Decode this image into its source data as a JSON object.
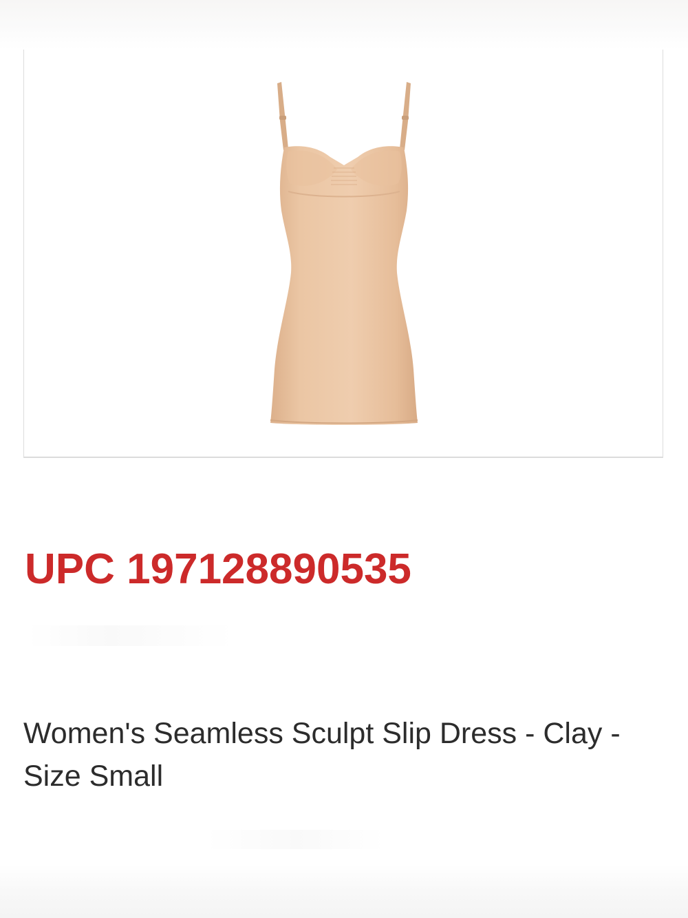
{
  "product": {
    "upc_text": "UPC 197128890535",
    "title": "Women's Seamless Sculpt Slip Dress - Clay - Size Small",
    "image_subject": "slip-dress",
    "color_hex": "#E8C2A0"
  }
}
